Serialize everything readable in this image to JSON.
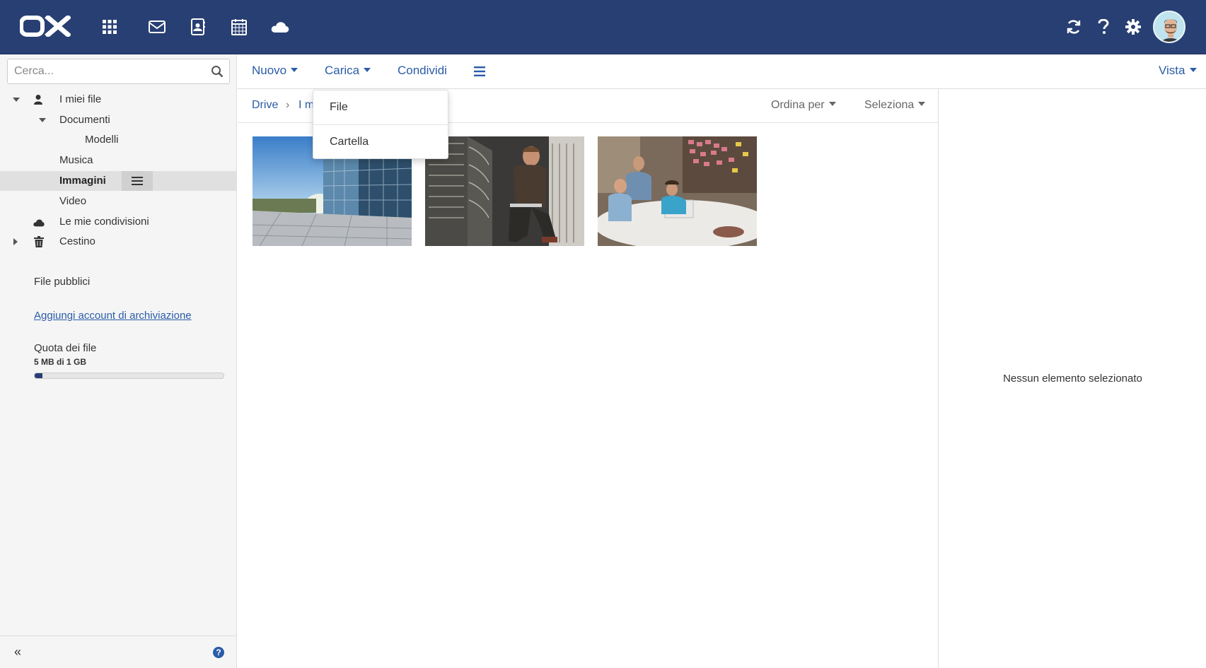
{
  "app": {
    "logo_text": "OX"
  },
  "topbar": {
    "icons": [
      "app-launcher-icon",
      "mail-icon",
      "contacts-icon",
      "calendar-icon",
      "drive-cloud-icon",
      "refresh-icon",
      "help-icon",
      "settings-icon"
    ],
    "bg_color": "#283f73"
  },
  "search": {
    "placeholder": "Cerca..."
  },
  "tree": {
    "my_files": "I miei file",
    "documents": "Documenti",
    "templates": "Modelli",
    "music": "Musica",
    "pictures": "Immagini",
    "video": "Video",
    "my_shares": "Le mie condivisioni",
    "trash": "Cestino"
  },
  "sidebar": {
    "public_files": "File pubblici",
    "add_storage": "Aggiungi account di archiviazione",
    "quota_title": "Quota dei file",
    "quota_text": "5 MB di 1 GB",
    "quota_fraction": 0.005,
    "collapse_label": "«",
    "help_label": "?"
  },
  "toolbar": {
    "new_label": "Nuovo",
    "upload_label": "Carica",
    "share_label": "Condividi",
    "view_label": "Vista"
  },
  "breadcrumb": {
    "root": "Drive",
    "separator": "›",
    "current_partial": "I m"
  },
  "sort": {
    "sort_label": "Ordina per",
    "select_label": "Seleziona"
  },
  "dropdown": {
    "items": [
      "File",
      "Cartella"
    ]
  },
  "detail": {
    "empty_text": "Nessun elemento selezionato"
  },
  "colors": {
    "accent": "#2a5ca8",
    "selected_row": "#e0e0e0"
  }
}
